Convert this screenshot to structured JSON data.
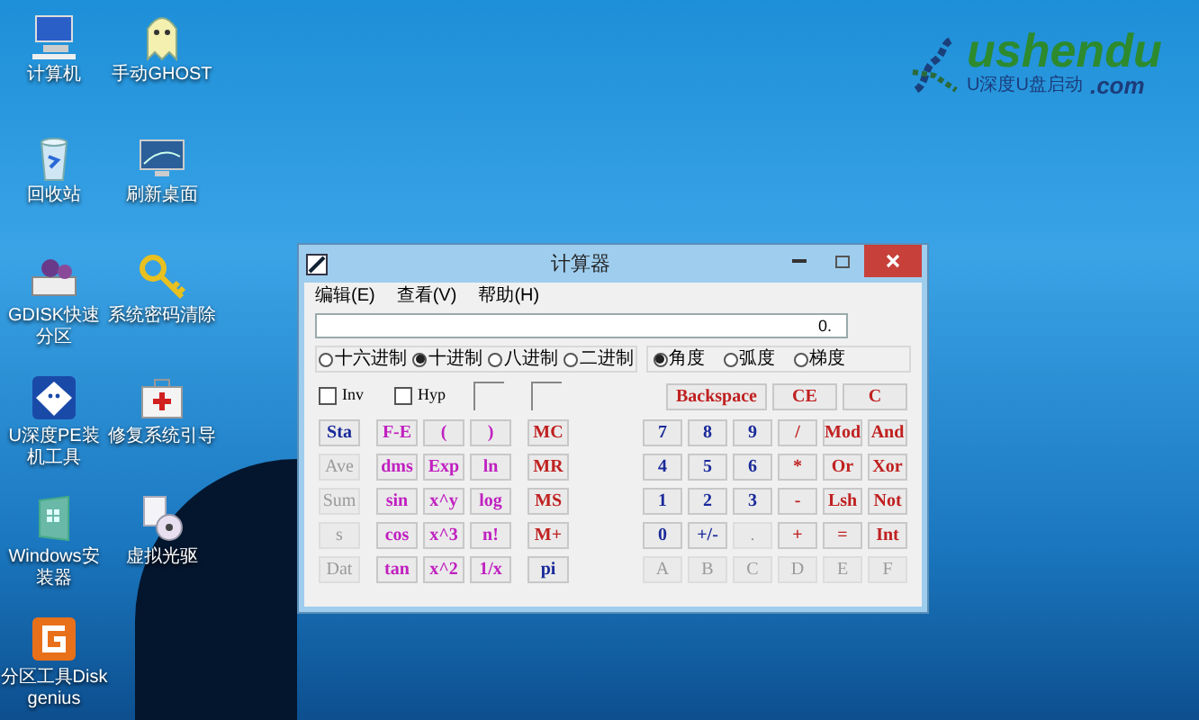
{
  "desktop_icons": [
    {
      "label": "计算机",
      "kind": "computer"
    },
    {
      "label": "手动GHOST",
      "kind": "ghost"
    },
    {
      "label": "回收站",
      "kind": "trash"
    },
    {
      "label": "刷新桌面",
      "kind": "monitor"
    },
    {
      "label": "GDISK快速分区",
      "kind": "disk"
    },
    {
      "label": "系统密码清除",
      "kind": "key"
    },
    {
      "label": "U深度PE装机工具",
      "kind": "badge"
    },
    {
      "label": "修复系统引导",
      "kind": "medkit"
    },
    {
      "label": "Windows安装器",
      "kind": "installer"
    },
    {
      "label": "虚拟光驱",
      "kind": "cd"
    },
    {
      "label": "分区工具Diskgenius",
      "kind": "partition"
    }
  ],
  "logo": {
    "name": "ushendu",
    "domain": ".com",
    "tagline": "U深度U盘启动"
  },
  "calculator": {
    "title": "计算器",
    "menu": [
      "编辑(E)",
      "查看(V)",
      "帮助(H)"
    ],
    "display": "0.",
    "number_bases": [
      {
        "label": "十六进制",
        "selected": false
      },
      {
        "label": "十进制",
        "selected": true
      },
      {
        "label": "八进制",
        "selected": false
      },
      {
        "label": "二进制",
        "selected": false
      }
    ],
    "angle_units": [
      {
        "label": "角度",
        "selected": true
      },
      {
        "label": "弧度",
        "selected": false
      },
      {
        "label": "梯度",
        "selected": false
      }
    ],
    "checkboxes": [
      {
        "label": "Inv",
        "checked": false
      },
      {
        "label": "Hyp",
        "checked": false
      }
    ],
    "edit_buttons": [
      {
        "label": "Backspace",
        "color": "#c02020"
      },
      {
        "label": "CE",
        "color": "#c02020"
      },
      {
        "label": "C",
        "color": "#c02020"
      }
    ],
    "left_buttons": [
      [
        {
          "label": "Sta",
          "color": "#1a2a9a",
          "disabled": false
        },
        {
          "label": "F-E",
          "color": "#c020c0",
          "disabled": false
        },
        {
          "label": "(",
          "color": "#c020c0",
          "disabled": false
        },
        {
          "label": ")",
          "color": "#c020c0",
          "disabled": false
        },
        {
          "label": "MC",
          "color": "#c02020",
          "disabled": false
        }
      ],
      [
        {
          "label": "Ave",
          "disabled": true
        },
        {
          "label": "dms",
          "color": "#c020c0",
          "disabled": false
        },
        {
          "label": "Exp",
          "color": "#c020c0",
          "disabled": false
        },
        {
          "label": "ln",
          "color": "#c020c0",
          "disabled": false
        },
        {
          "label": "MR",
          "color": "#c02020",
          "disabled": false
        }
      ],
      [
        {
          "label": "Sum",
          "disabled": true
        },
        {
          "label": "sin",
          "color": "#c020c0",
          "disabled": false
        },
        {
          "label": "x^y",
          "color": "#c020c0",
          "disabled": false
        },
        {
          "label": "log",
          "color": "#c020c0",
          "disabled": false
        },
        {
          "label": "MS",
          "color": "#c02020",
          "disabled": false
        }
      ],
      [
        {
          "label": "s",
          "disabled": true
        },
        {
          "label": "cos",
          "color": "#c020c0",
          "disabled": false
        },
        {
          "label": "x^3",
          "color": "#c020c0",
          "disabled": false
        },
        {
          "label": "n!",
          "color": "#c020c0",
          "disabled": false
        },
        {
          "label": "M+",
          "color": "#c02020",
          "disabled": false
        }
      ],
      [
        {
          "label": "Dat",
          "disabled": true
        },
        {
          "label": "tan",
          "color": "#c020c0",
          "disabled": false
        },
        {
          "label": "x^2",
          "color": "#c020c0",
          "disabled": false
        },
        {
          "label": "1/x",
          "color": "#c020c0",
          "disabled": false
        },
        {
          "label": "pi",
          "color": "#1a2a9a",
          "disabled": false
        }
      ]
    ],
    "right_buttons": [
      [
        {
          "label": "7",
          "color": "#1a2a9a",
          "disabled": false
        },
        {
          "label": "8",
          "color": "#1a2a9a",
          "disabled": false
        },
        {
          "label": "9",
          "color": "#1a2a9a",
          "disabled": false
        },
        {
          "label": "/",
          "color": "#c02020",
          "disabled": false
        },
        {
          "label": "Mod",
          "color": "#c02020",
          "disabled": false
        },
        {
          "label": "And",
          "color": "#c02020",
          "disabled": false
        }
      ],
      [
        {
          "label": "4",
          "color": "#1a2a9a",
          "disabled": false
        },
        {
          "label": "5",
          "color": "#1a2a9a",
          "disabled": false
        },
        {
          "label": "6",
          "color": "#1a2a9a",
          "disabled": false
        },
        {
          "label": "*",
          "color": "#c02020",
          "disabled": false
        },
        {
          "label": "Or",
          "color": "#c02020",
          "disabled": false
        },
        {
          "label": "Xor",
          "color": "#c02020",
          "disabled": false
        }
      ],
      [
        {
          "label": "1",
          "color": "#1a2a9a",
          "disabled": false
        },
        {
          "label": "2",
          "color": "#1a2a9a",
          "disabled": false
        },
        {
          "label": "3",
          "color": "#1a2a9a",
          "disabled": false
        },
        {
          "label": "-",
          "color": "#c02020",
          "disabled": false
        },
        {
          "label": "Lsh",
          "color": "#c02020",
          "disabled": false
        },
        {
          "label": "Not",
          "color": "#c02020",
          "disabled": false
        }
      ],
      [
        {
          "label": "0",
          "color": "#1a2a9a",
          "disabled": false
        },
        {
          "label": "+/-",
          "color": "#1a2a9a",
          "disabled": false
        },
        {
          "label": ".",
          "disabled": true
        },
        {
          "label": "+",
          "color": "#c02020",
          "disabled": false
        },
        {
          "label": "=",
          "color": "#c02020",
          "disabled": false
        },
        {
          "label": "Int",
          "color": "#c02020",
          "disabled": false
        }
      ],
      [
        {
          "label": "A",
          "disabled": true
        },
        {
          "label": "B",
          "disabled": true
        },
        {
          "label": "C",
          "disabled": true
        },
        {
          "label": "D",
          "disabled": true
        },
        {
          "label": "E",
          "disabled": true
        },
        {
          "label": "F",
          "disabled": true
        }
      ]
    ]
  }
}
